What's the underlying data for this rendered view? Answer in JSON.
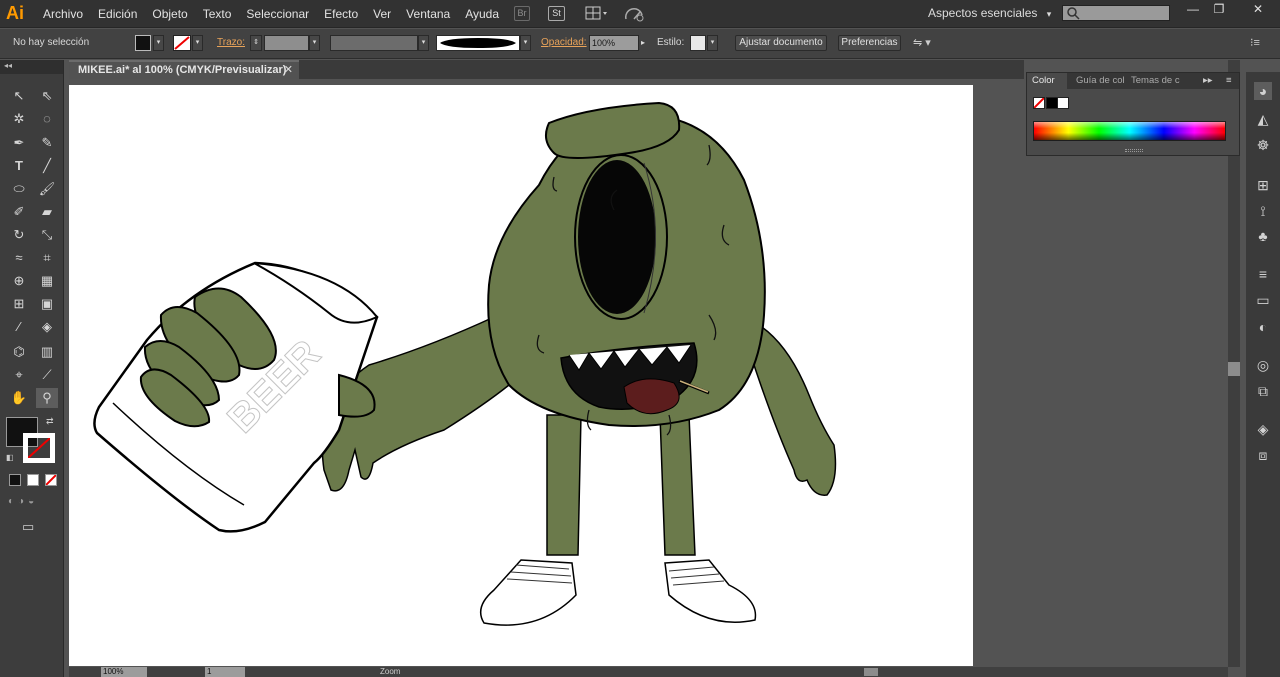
{
  "app": {
    "logo": "Ai"
  },
  "menu": [
    "Archivo",
    "Edición",
    "Objeto",
    "Texto",
    "Seleccionar",
    "Efecto",
    "Ver",
    "Ventana",
    "Ayuda"
  ],
  "menubar_icons": {
    "bridge": "Br",
    "stock": "St"
  },
  "workspace": {
    "label": "Aspectos esenciales",
    "arrow": "▾"
  },
  "window_buttons": {
    "minimize": "—",
    "maximize": "❐",
    "close": "✕"
  },
  "control_bar": {
    "selection": "No hay selección",
    "stroke_label": "Trazo:",
    "opacity_label": "Opacidad:",
    "opacity_value": "100%",
    "style_label": "Estilo:",
    "fit_document": "Ajustar documento",
    "preferences": "Preferencias"
  },
  "document": {
    "tab_title": "MIKEE.ai* al 100% (CMYK/Previsualizar)",
    "close": "✕"
  },
  "toolbox": {
    "collapse": "◂◂"
  },
  "color_panel": {
    "tabs": [
      "Color",
      "Guía de col",
      "Temas de c"
    ],
    "menu": "≡"
  },
  "status_bar": {
    "zoom": "100%",
    "page": "1",
    "label": "Zoom"
  },
  "colors": {
    "character_green": "#6b7a4b",
    "mouth_red": "#5c1d1d",
    "accent": "#e8a35a"
  },
  "artwork_text": {
    "cup_label": "BEER"
  }
}
